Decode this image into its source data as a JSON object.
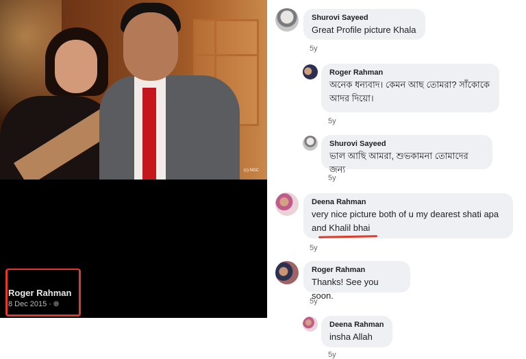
{
  "post": {
    "photo_watermark": "(c) NGC",
    "poster_name": "Roger Rahman",
    "date": "8 Dec 2015",
    "separator": "·",
    "audience_icon": "globe-icon"
  },
  "comments": [
    {
      "author": "Shurovi Sayeed",
      "text": "Great Profile picture Khala",
      "age": "5y"
    },
    {
      "author": "Roger Rahman",
      "text": "অনেক ধন্যবাদ। কেমন আছ তোমরা? সাঁকোকে আদর দিয়ো।",
      "age": "5y"
    },
    {
      "author": "Shurovi Sayeed",
      "text": "ভাল আছি আমরা, শুভকামনা তোমাদের জন্য",
      "age": "5y"
    },
    {
      "author": "Deena Rahman",
      "text": "very nice picture both of u my dearest shati apa and Khalil bhai",
      "age": "5y"
    },
    {
      "author": "Roger Rahman",
      "text": "Thanks! See you soon.",
      "age": "5y"
    },
    {
      "author": "Deena Rahman",
      "text": "insha Allah",
      "age": "5y"
    }
  ],
  "colors": {
    "annotation_red": "#e03a2a",
    "bubble_bg": "#eef0f3"
  }
}
